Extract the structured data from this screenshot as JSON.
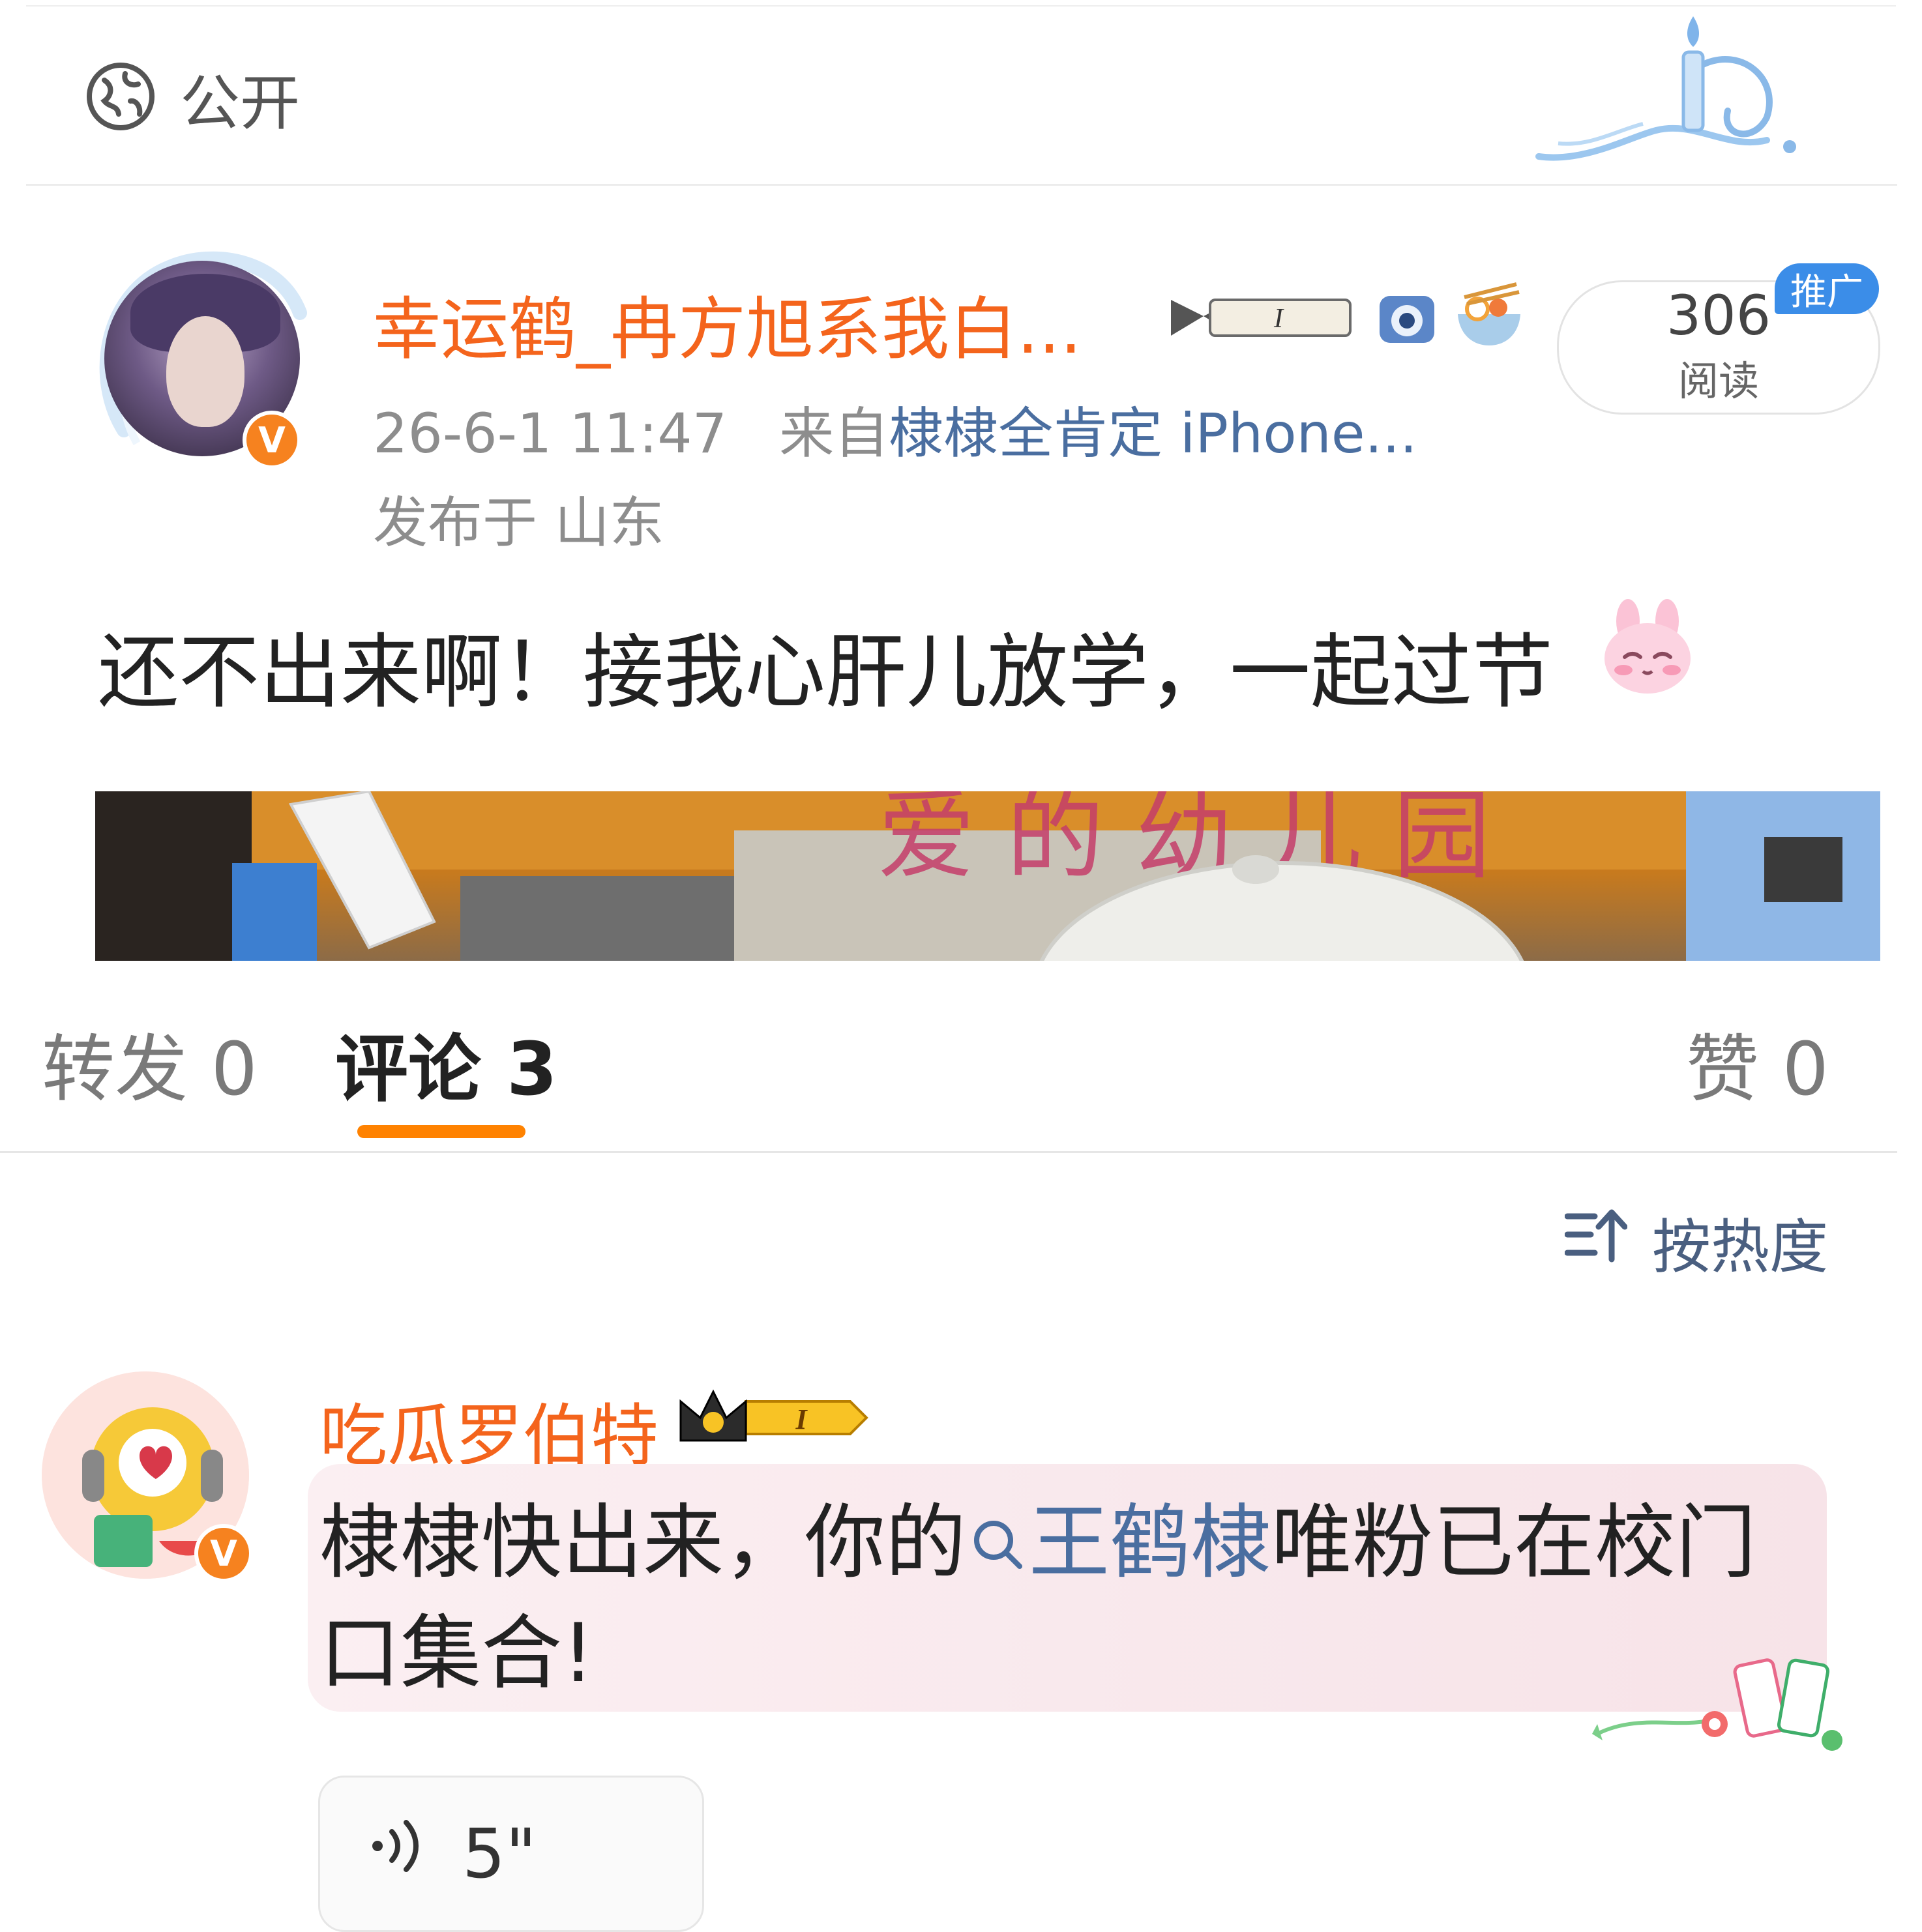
{
  "visibility": {
    "icon": "globe-icon",
    "label": "公开"
  },
  "post": {
    "username": "幸运鹤_冉方旭系我白...",
    "time": "26-6-1 11:47",
    "from_prefix": "来自",
    "source": "棣棣全肯定 iPhone...",
    "location": "发布于 山东",
    "read_count": "306",
    "read_label": "阅读",
    "promo_badge": "推广",
    "text": "还不出来啊！接我心肝儿放学，一起过节",
    "emoji": "shy-bunny-emoji"
  },
  "tabs": [
    {
      "label": "转发 0"
    },
    {
      "label": "评论 3"
    },
    {
      "label": "赞 0"
    }
  ],
  "sort": {
    "icon": "sort-icon",
    "label": "按热度"
  },
  "comment": {
    "username": "吃瓜罗伯特",
    "badge_level": "I",
    "text_before": "棣棣快出来，你的",
    "topic": "王鹤棣",
    "text_after": "唯粉已在校门口集合!",
    "voice_duration": "5\""
  },
  "colors": {
    "accent_orange": "#f4641c",
    "link_blue": "#4a6ea0",
    "tab_underline": "#ff8200",
    "promo_blue": "#3b8de8"
  }
}
